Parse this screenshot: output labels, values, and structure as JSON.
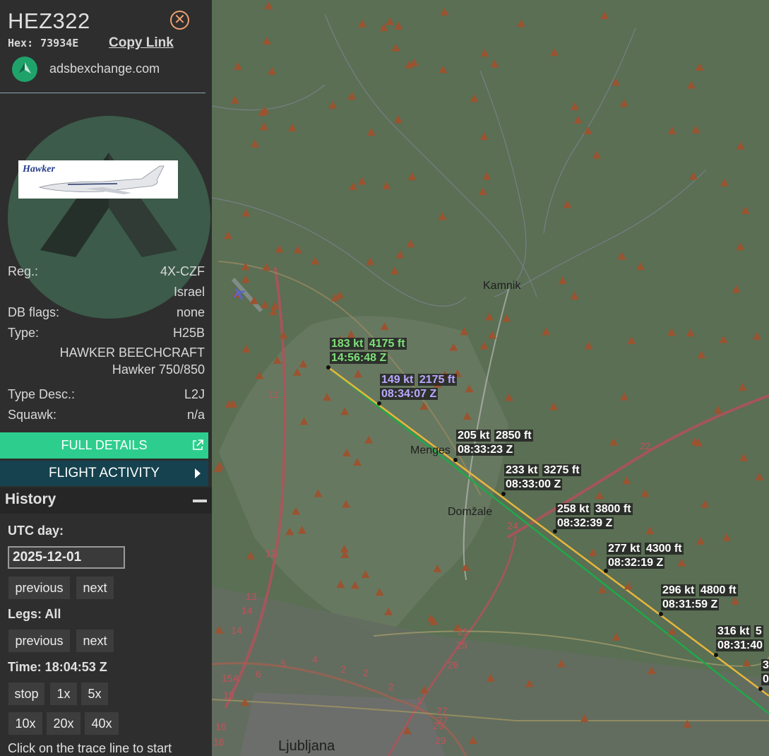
{
  "aircraft": {
    "callsign": "HEZ322",
    "hex_label": "Hex:",
    "hex": "73934E",
    "copy_link": "Copy Link",
    "source": "adsbexchange.com",
    "close_symbol": "✕",
    "details": {
      "reg_label": "Reg.:",
      "reg": "4X-CZF",
      "country": "Israel",
      "dbflags_label": "DB flags:",
      "dbflags": "none",
      "type_label": "Type:",
      "type": "H25B",
      "manufacturer": "HAWKER BEECHCRAFT",
      "model": "Hawker 750/850",
      "typedesc_label": "Type Desc.:",
      "typedesc": "L2J",
      "squawk_label": "Squawk:",
      "squawk": "n/a"
    }
  },
  "buttons": {
    "full_details": "FULL DETAILS",
    "flight_activity": "FLIGHT ACTIVITY"
  },
  "history": {
    "title": "History",
    "utc_day_label": "UTC day:",
    "utc_day": "2025-12-01",
    "prev": "previous",
    "next": "next",
    "legs_label": "Legs: All",
    "time_label": "Time: 18:04:53 Z",
    "speed_buttons": [
      "stop",
      "1x",
      "5x",
      "10x",
      "20x",
      "40x"
    ],
    "hint": "Click on the trace line to start"
  },
  "map": {
    "places": [
      "Kamnik",
      "Menges",
      "Domžale",
      "Ljubljana"
    ],
    "road_numbers": [
      "11",
      "12",
      "13",
      "14",
      "14",
      "22",
      "24",
      "25",
      "25",
      "26",
      "2",
      "2",
      "2",
      "4",
      "5",
      "6",
      "15A",
      "15",
      "16",
      "16",
      "27",
      "27",
      "29",
      "29",
      "1"
    ],
    "trace_points": [
      {
        "speed": "183 kt",
        "alt": "4175 ft",
        "time": "14:56:48 Z"
      },
      {
        "speed": "149 kt",
        "alt": "2175 ft",
        "time": "08:34:07 Z"
      },
      {
        "speed": "205 kt",
        "alt": "2850 ft",
        "time": "08:33:23 Z"
      },
      {
        "speed": "233 kt",
        "alt": "3275 ft",
        "time": "08:33:00 Z"
      },
      {
        "speed": "258 kt",
        "alt": "3800 ft",
        "time": "08:32:39 Z"
      },
      {
        "speed": "277 kt",
        "alt": "4300 ft",
        "time": "08:32:19 Z"
      },
      {
        "speed": "296 kt",
        "alt": "4800 ft",
        "time": "08:31:59 Z"
      },
      {
        "speed": "316 kt",
        "alt": "5",
        "time": "08:31:40"
      },
      {
        "speed": "3",
        "alt": "",
        "time": "0"
      }
    ]
  }
}
